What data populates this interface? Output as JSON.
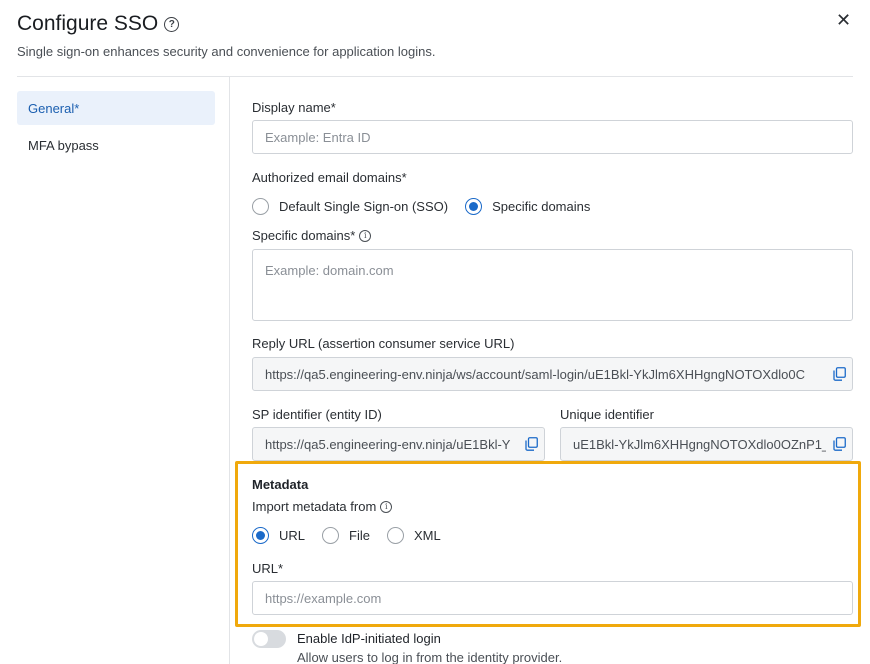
{
  "header": {
    "title": "Configure SSO",
    "subtitle": "Single sign-on enhances security and convenience for application logins.",
    "help_glyph": "?",
    "close_glyph": "✕"
  },
  "nav": {
    "items": [
      {
        "label": "General*",
        "active": true
      },
      {
        "label": "MFA bypass",
        "active": false
      }
    ]
  },
  "form": {
    "display_name": {
      "label": "Display name*",
      "placeholder": "Example: Entra ID"
    },
    "authorized_domains": {
      "label": "Authorized email domains*",
      "options": [
        "Default Single Sign-on (SSO)",
        "Specific domains"
      ],
      "selected": "Specific domains"
    },
    "specific_domains": {
      "label": "Specific domains*",
      "placeholder": "Example: domain.com"
    },
    "reply_url": {
      "label": "Reply URL (assertion consumer service URL)",
      "value": "https://qa5.engineering-env.ninja/ws/account/saml-login/uE1Bkl-YkJlm6XHHgngNOTOXdlo0C"
    },
    "sp_identifier": {
      "label": "SP identifier (entity ID)",
      "value": "https://qa5.engineering-env.ninja/uE1Bkl-Y"
    },
    "unique_identifier": {
      "label": "Unique identifier",
      "value": "uE1Bkl-YkJlm6XHHgngNOTOXdlo0OZnP1_"
    }
  },
  "metadata": {
    "title": "Metadata",
    "import_label": "Import metadata from",
    "options": [
      "URL",
      "File",
      "XML"
    ],
    "selected": "URL",
    "url_label": "URL*",
    "url_placeholder": "https://example.com"
  },
  "idp": {
    "label": "Enable IdP-initiated login",
    "description": "Allow users to log in from the identity provider.",
    "enabled": false
  },
  "colors": {
    "accent": "#1b6ac9",
    "highlight": "#f0a90c",
    "nav_active_bg": "#eaf1fb"
  },
  "icons": {
    "info": "i",
    "copy": "copy-icon"
  }
}
